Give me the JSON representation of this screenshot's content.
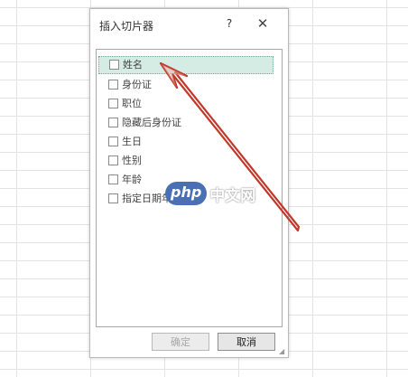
{
  "dialog": {
    "title": "插入切片器",
    "help_label": "?",
    "close_label": "✕",
    "items": [
      {
        "label": "姓名",
        "checked": false,
        "selected": true
      },
      {
        "label": "身份证",
        "checked": false,
        "selected": false
      },
      {
        "label": "职位",
        "checked": false,
        "selected": false
      },
      {
        "label": "隐藏后身份证",
        "checked": false,
        "selected": false
      },
      {
        "label": "生日",
        "checked": false,
        "selected": false
      },
      {
        "label": "性别",
        "checked": false,
        "selected": false
      },
      {
        "label": "年龄",
        "checked": false,
        "selected": false
      },
      {
        "label": "指定日期年龄",
        "checked": false,
        "selected": false
      }
    ],
    "ok_label": "确定",
    "cancel_label": "取消"
  },
  "watermark": {
    "logo": "php",
    "text": "中文网"
  },
  "colors": {
    "arrow": "#c0392b",
    "selection": "#d5ece5"
  }
}
